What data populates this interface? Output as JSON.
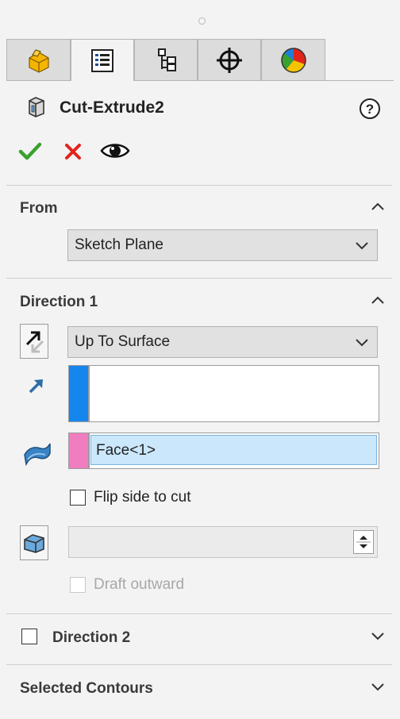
{
  "feature": {
    "title": "Cut-Extrude2"
  },
  "tabs": [
    {
      "name": "featuremanager-tab",
      "icon": "part-tree-icon"
    },
    {
      "name": "propertymanager-tab",
      "icon": "property-list-icon"
    },
    {
      "name": "configurationmanager-tab",
      "icon": "configuration-icon"
    },
    {
      "name": "dimxpert-tab",
      "icon": "crosshair-icon"
    },
    {
      "name": "display-manager-tab",
      "icon": "appearance-pie-icon"
    }
  ],
  "from": {
    "header": "From",
    "value": "Sketch Plane"
  },
  "direction1": {
    "header": "Direction 1",
    "end_condition": "Up To Surface",
    "direction_selection": "",
    "face_selection": "Face<1>",
    "flip_side_label": "Flip side to cut",
    "draft_value": "",
    "draft_outward_label": "Draft outward"
  },
  "direction2": {
    "header": "Direction 2"
  },
  "selected_contours": {
    "header": "Selected Contours"
  },
  "colors": {
    "ok_green": "#3aa02f",
    "cancel_red": "#e2231a",
    "selection_blue": "#1686ef",
    "selection_pink": "#f07dc0",
    "active_field": "#cbe7fb"
  }
}
